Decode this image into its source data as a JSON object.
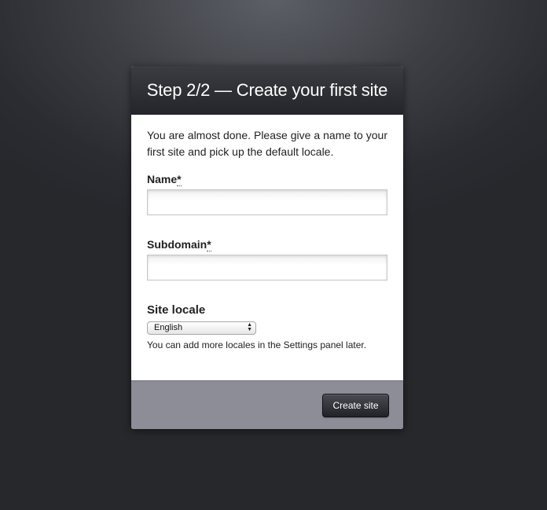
{
  "header": {
    "title": "Step 2/2 — Create your first site"
  },
  "intro": {
    "text": "You are almost done. Please give a name to your first site and pick up the default locale."
  },
  "form": {
    "name": {
      "label": "Name",
      "required_mark": "*",
      "value": ""
    },
    "subdomain": {
      "label": "Subdomain",
      "required_mark": "*",
      "value": ""
    },
    "locale": {
      "label": "Site locale",
      "selected": "English",
      "hint": "You can add more locales in the Settings panel later."
    }
  },
  "footer": {
    "submit_label": "Create site"
  },
  "colors": {
    "header_bg": "#2e2f34",
    "footer_bg": "#8c8d97",
    "button_bg": "#2a2b30"
  }
}
